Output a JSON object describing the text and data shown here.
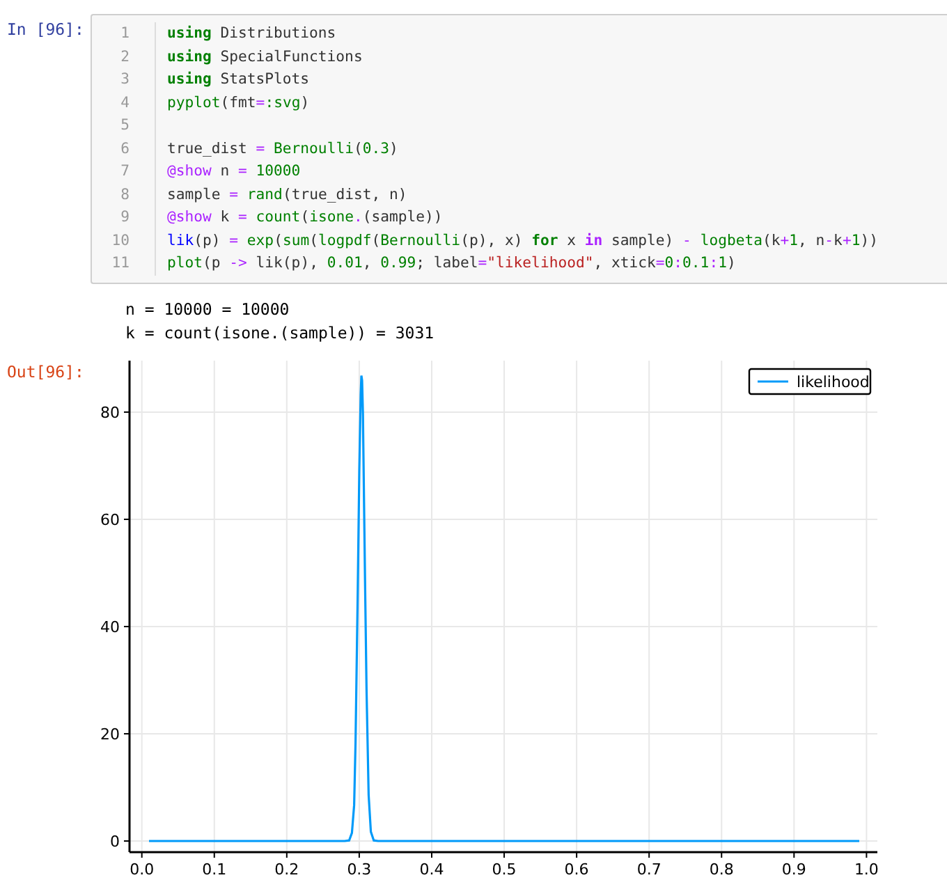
{
  "input_cell": {
    "prompt": "In [96]:",
    "lines": [
      {
        "number": "1",
        "tokens": [
          {
            "kind": "keyword",
            "text": "using"
          },
          {
            "kind": "plain",
            "text": " Distributions"
          }
        ]
      },
      {
        "number": "2",
        "tokens": [
          {
            "kind": "keyword",
            "text": "using"
          },
          {
            "kind": "plain",
            "text": " SpecialFunctions"
          }
        ]
      },
      {
        "number": "3",
        "tokens": [
          {
            "kind": "keyword",
            "text": "using"
          },
          {
            "kind": "plain",
            "text": " StatsPlots"
          }
        ]
      },
      {
        "number": "4",
        "tokens": [
          {
            "kind": "builtin",
            "text": "pyplot"
          },
          {
            "kind": "plain",
            "text": "(fmt"
          },
          {
            "kind": "operator",
            "text": "="
          },
          {
            "kind": "symbol",
            "text": ":svg"
          },
          {
            "kind": "plain",
            "text": ")"
          }
        ]
      },
      {
        "number": "5"
      },
      {
        "number": "6",
        "tokens": [
          {
            "kind": "plain",
            "text": "true_dist "
          },
          {
            "kind": "operator",
            "text": "= "
          },
          {
            "kind": "builtin",
            "text": "Bernoulli"
          },
          {
            "kind": "plain",
            "text": "("
          },
          {
            "kind": "number",
            "text": "0.3"
          },
          {
            "kind": "plain",
            "text": ")"
          }
        ]
      },
      {
        "number": "7",
        "tokens": [
          {
            "kind": "macro",
            "text": "@show"
          },
          {
            "kind": "plain",
            "text": " n "
          },
          {
            "kind": "operator",
            "text": "= "
          },
          {
            "kind": "number",
            "text": "10000"
          }
        ]
      },
      {
        "number": "8",
        "tokens": [
          {
            "kind": "plain",
            "text": "sample "
          },
          {
            "kind": "operator",
            "text": "= "
          },
          {
            "kind": "builtin",
            "text": "rand"
          },
          {
            "kind": "plain",
            "text": "(true_dist, n)"
          }
        ]
      },
      {
        "number": "9",
        "tokens": [
          {
            "kind": "macro",
            "text": "@show"
          },
          {
            "kind": "plain",
            "text": " k "
          },
          {
            "kind": "operator",
            "text": "= "
          },
          {
            "kind": "builtin",
            "text": "count"
          },
          {
            "kind": "plain",
            "text": "("
          },
          {
            "kind": "builtin",
            "text": "isone"
          },
          {
            "kind": "operator",
            "text": "."
          },
          {
            "kind": "plain",
            "text": "(sample))"
          }
        ]
      },
      {
        "number": "10",
        "tokens": [
          {
            "kind": "definition",
            "text": "lik"
          },
          {
            "kind": "plain",
            "text": "(p) "
          },
          {
            "kind": "operator",
            "text": "= "
          },
          {
            "kind": "builtin",
            "text": "exp"
          },
          {
            "kind": "plain",
            "text": "("
          },
          {
            "kind": "builtin",
            "text": "sum"
          },
          {
            "kind": "plain",
            "text": "("
          },
          {
            "kind": "builtin",
            "text": "logpdf"
          },
          {
            "kind": "plain",
            "text": "("
          },
          {
            "kind": "builtin",
            "text": "Bernoulli"
          },
          {
            "kind": "plain",
            "text": "(p), x) "
          },
          {
            "kind": "keyword",
            "text": "for"
          },
          {
            "kind": "plain",
            "text": " x "
          },
          {
            "kind": "keyword_operator",
            "text": "in"
          },
          {
            "kind": "plain",
            "text": " sample) "
          },
          {
            "kind": "operator",
            "text": "- "
          },
          {
            "kind": "builtin",
            "text": "logbeta"
          },
          {
            "kind": "plain",
            "text": "(k"
          },
          {
            "kind": "operator",
            "text": "+"
          },
          {
            "kind": "number",
            "text": "1"
          },
          {
            "kind": "plain",
            "text": ", n"
          },
          {
            "kind": "operator",
            "text": "-"
          },
          {
            "kind": "plain",
            "text": "k"
          },
          {
            "kind": "operator",
            "text": "+"
          },
          {
            "kind": "number",
            "text": "1"
          },
          {
            "kind": "plain",
            "text": "))"
          }
        ]
      },
      {
        "number": "11",
        "tokens": [
          {
            "kind": "builtin",
            "text": "plot"
          },
          {
            "kind": "plain",
            "text": "(p "
          },
          {
            "kind": "operator",
            "text": "->"
          },
          {
            "kind": "plain",
            "text": " lik(p), "
          },
          {
            "kind": "number",
            "text": "0.01"
          },
          {
            "kind": "plain",
            "text": ", "
          },
          {
            "kind": "number",
            "text": "0.99"
          },
          {
            "kind": "plain",
            "text": "; label"
          },
          {
            "kind": "operator",
            "text": "="
          },
          {
            "kind": "string",
            "text": "\"likelihood\""
          },
          {
            "kind": "plain",
            "text": ", xtick"
          },
          {
            "kind": "operator",
            "text": "="
          },
          {
            "kind": "number",
            "text": "0"
          },
          {
            "kind": "operator",
            "text": ":"
          },
          {
            "kind": "number",
            "text": "0.1"
          },
          {
            "kind": "operator",
            "text": ":"
          },
          {
            "kind": "number",
            "text": "1"
          },
          {
            "kind": "plain",
            "text": ")"
          }
        ]
      }
    ]
  },
  "stdout": [
    "n = 10000 = 10000",
    "k = count(isone.(sample)) = 3031"
  ],
  "output_cell": {
    "prompt": "Out[96]:",
    "chart_data": {
      "type": "line",
      "x": [
        0.01,
        0.1,
        0.2,
        0.28,
        0.286,
        0.29,
        0.293,
        0.295,
        0.298,
        0.3,
        0.302,
        0.303,
        0.304,
        0.305,
        0.308,
        0.31,
        0.313,
        0.316,
        0.32,
        0.326,
        0.33,
        0.4,
        0.5,
        0.6,
        0.7,
        0.8,
        0.9,
        0.99
      ],
      "series": [
        {
          "name": "likelihood",
          "color": "#009af9",
          "values": [
            0,
            0,
            0,
            0,
            0.1,
            1.5,
            6.7,
            18.4,
            46.9,
            69.2,
            83.3,
            86.8,
            85.9,
            79.7,
            48.9,
            28.2,
            8.6,
            1.7,
            0.1,
            0,
            0,
            0,
            0,
            0,
            0,
            0,
            0,
            0
          ]
        }
      ],
      "grid": true,
      "xlim": [
        -0.017,
        1.015
      ],
      "ylim": [
        -2.08,
        89.6
      ],
      "xticks": [
        {
          "value": 0,
          "label": "0.0"
        },
        {
          "value": 0.1,
          "label": "0.1"
        },
        {
          "value": 0.2,
          "label": "0.2"
        },
        {
          "value": 0.3,
          "label": "0.3"
        },
        {
          "value": 0.4,
          "label": "0.4"
        },
        {
          "value": 0.5,
          "label": "0.5"
        },
        {
          "value": 0.6,
          "label": "0.6"
        },
        {
          "value": 0.7,
          "label": "0.7"
        },
        {
          "value": 0.8,
          "label": "0.8"
        },
        {
          "value": 0.9,
          "label": "0.9"
        },
        {
          "value": 1,
          "label": "1.0"
        }
      ],
      "yticks": [
        0,
        20,
        40,
        60,
        80
      ]
    }
  }
}
